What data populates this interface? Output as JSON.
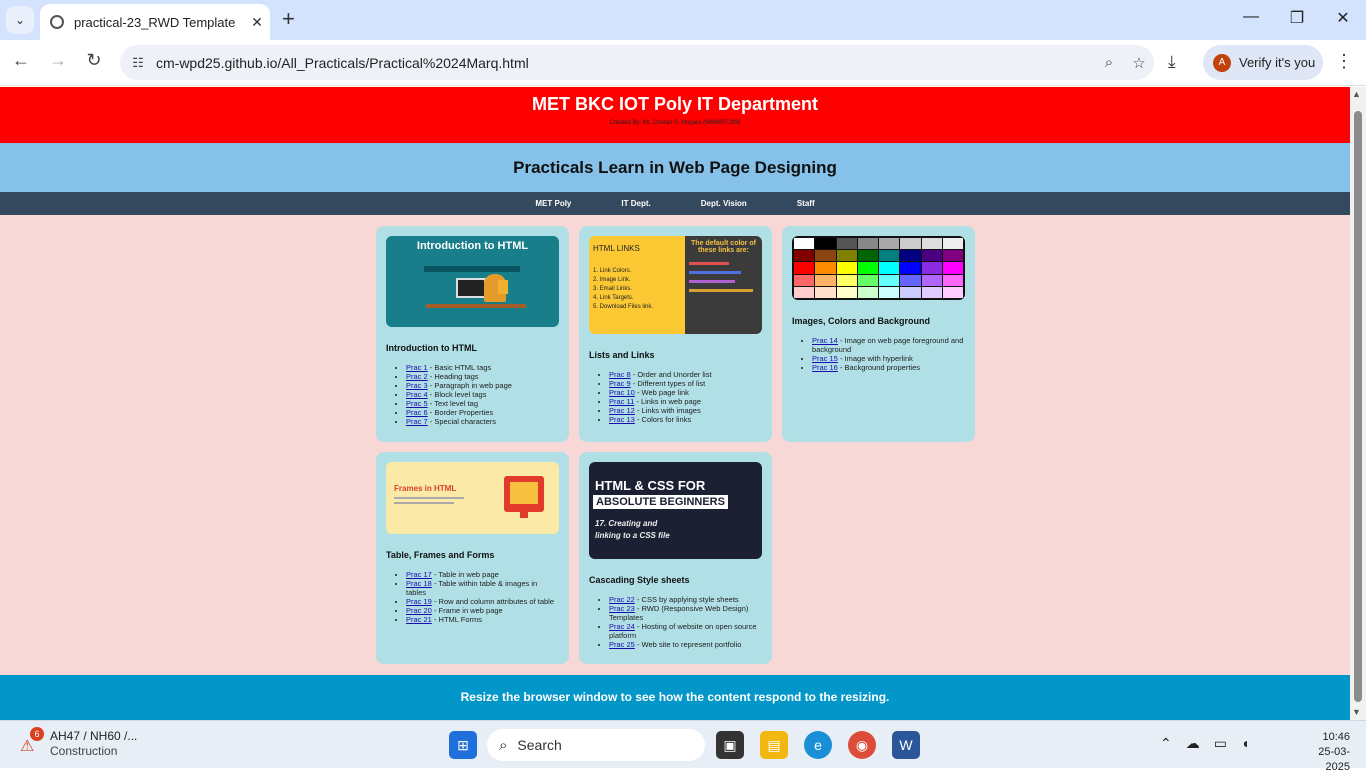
{
  "browser": {
    "tab_title": "practical-23_RWD Template",
    "url": "cm-wpd25.github.io/All_Practicals/Practical%2024Marq.html",
    "profile_label": "Verify it's you",
    "profile_initial": "A"
  },
  "page": {
    "header_title": "MET BKC IOT Poly IT Department",
    "header_sub": "Created By: Mr. Chetan S. Mogare (8888607289)",
    "band_title": "Practicals Learn in Web Page Designing",
    "nav": [
      "MET Poly",
      "IT Dept.",
      "Dept. Vision",
      "Staff"
    ],
    "footer": "Resize the browser window to see how the content respond to the resizing."
  },
  "cards": [
    {
      "title": "Introduction to HTML",
      "image_caption": "Introduction to HTML",
      "items": [
        {
          "link": "Prac 1",
          "text": " - Basic HTML tags"
        },
        {
          "link": "Prac 2",
          "text": " - Heading tags"
        },
        {
          "link": "Prac 3",
          "text": " - Paragraph in web page"
        },
        {
          "link": "Prac 4",
          "text": " - Block level tags"
        },
        {
          "link": "Prac 5",
          "text": " - Text level tag"
        },
        {
          "link": "Prac 6",
          "text": " - Border Properties"
        },
        {
          "link": "Prac 7",
          "text": " - Special characters"
        }
      ]
    },
    {
      "title": "Lists and Links",
      "image_caption": "HTML LINKS",
      "image_lines": [
        "1. Link Colors.",
        "2. Image Link.",
        "3. Email Links.",
        "4. Link Targets.",
        "5. Download Files link."
      ],
      "image_side": "The default color of these links are:",
      "items": [
        {
          "link": "Prac 8",
          "text": " - Order and Unorder list"
        },
        {
          "link": "Prac 9",
          "text": " - Different types of list"
        },
        {
          "link": "Prac 10",
          "text": " - Web page link"
        },
        {
          "link": "Prac 11",
          "text": " - Links in web page"
        },
        {
          "link": "Prac 12",
          "text": " - Links with images"
        },
        {
          "link": "Prac 13",
          "text": " - Colors for links"
        }
      ]
    },
    {
      "title": "Images, Colors and Background",
      "items": [
        {
          "link": "Prac 14",
          "text": " - Image on web page foreground and background"
        },
        {
          "link": "Prac 15",
          "text": " - Image with hyperlink"
        },
        {
          "link": "Prac 16",
          "text": " - Background properties"
        }
      ]
    },
    {
      "title": "Table, Frames and Forms",
      "image_caption": "Frames in HTML",
      "items": [
        {
          "link": "Prac 17",
          "text": " - Table in web page"
        },
        {
          "link": "Prac 18",
          "text": " - Table within table & images in tables"
        },
        {
          "link": "Prac 19",
          "text": " - Row and column attributes of table"
        },
        {
          "link": "Prac 20",
          "text": " - Frame in web page"
        },
        {
          "link": "Prac 21",
          "text": " - HTML Forms"
        }
      ]
    },
    {
      "title": "Cascading Style sheets",
      "image_caption": "HTML & CSS FOR",
      "image_caption2": "ABSOLUTE BEGINNERS",
      "image_caption3": "17. Creating and linking to a CSS file",
      "items": [
        {
          "link": "Prac 22",
          "text": " - CSS by applying style sheets"
        },
        {
          "link": "Prac 23",
          "text": " - RWD (Responsive Web Design) Templates"
        },
        {
          "link": "Prac 24",
          "text": " - Hosting of website on open source platform"
        },
        {
          "link": "Prac 25",
          "text": " - Web site to represent portfolio"
        }
      ]
    }
  ],
  "taskbar": {
    "weather_title": "AH47 / NH60 /...",
    "weather_sub": "Construction",
    "weather_badge": "6",
    "search_placeholder": "Search",
    "time": "10:46",
    "date": "25-03-2025"
  }
}
